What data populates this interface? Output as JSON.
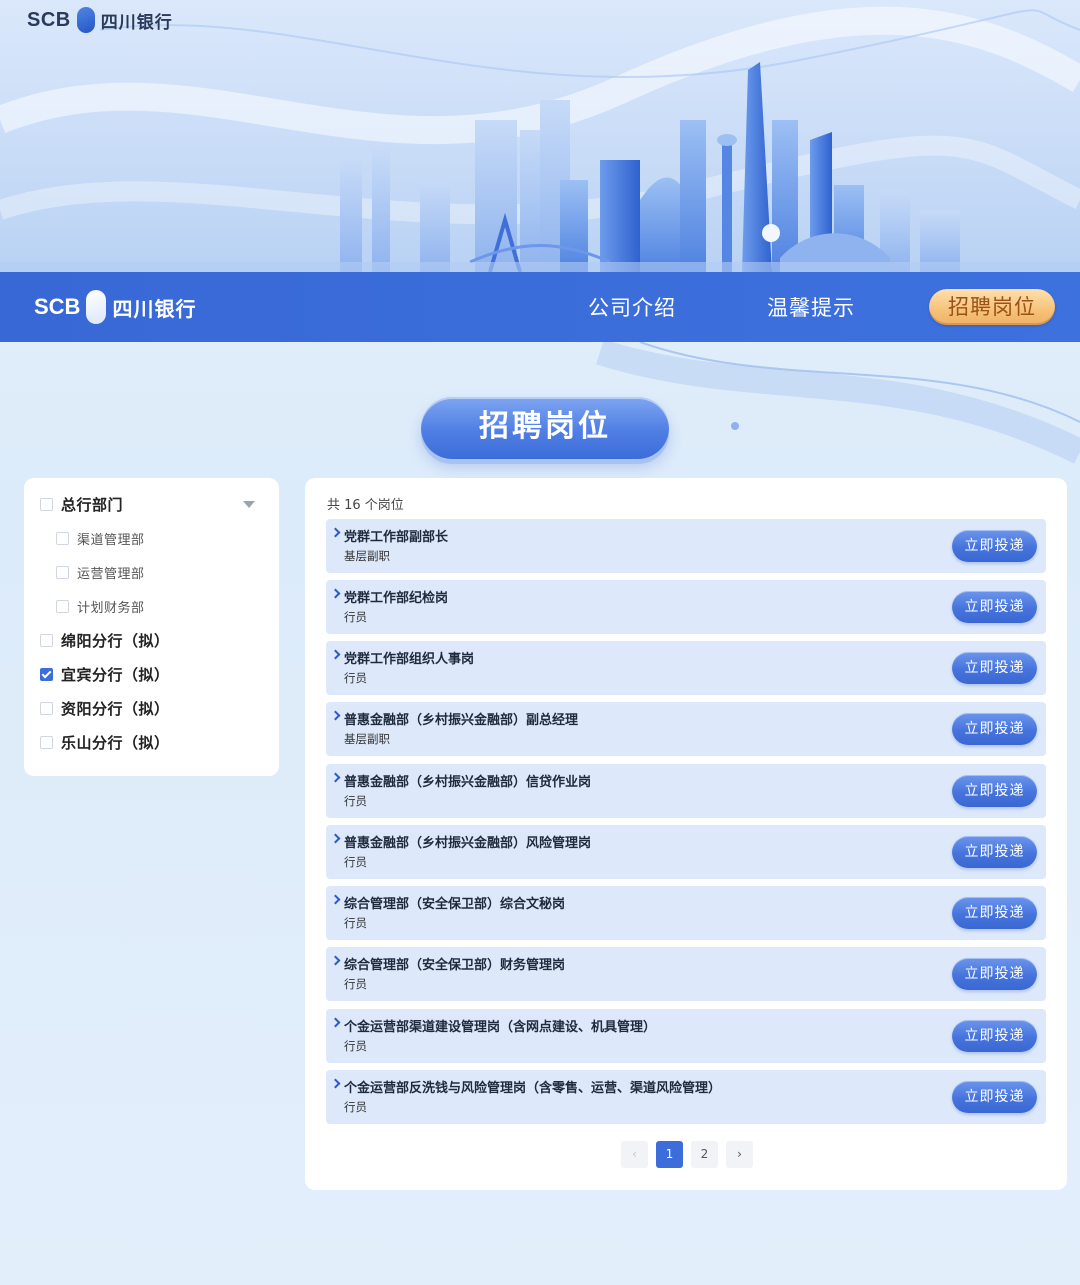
{
  "brand": {
    "latin": "SCB",
    "chinese": "四川银行"
  },
  "nav": {
    "company_intro": "公司介绍",
    "warm_tips": "温馨提示",
    "recruitment": "招聘岗位"
  },
  "section_title": "招聘岗位",
  "filters": {
    "groups": [
      {
        "label": "总行部门",
        "checked": false,
        "sub": true
      },
      {
        "label": "渠道管理部",
        "checked": false,
        "level": 2
      },
      {
        "label": "运营管理部",
        "checked": false,
        "level": 2
      },
      {
        "label": "计划财务部",
        "checked": false,
        "level": 2
      },
      {
        "label": "绵阳分行（拟）",
        "checked": false,
        "level": 1
      },
      {
        "label": "宜宾分行（拟）",
        "checked": true,
        "level": 1
      },
      {
        "label": "资阳分行（拟）",
        "checked": false,
        "level": 1
      },
      {
        "label": "乐山分行（拟）",
        "checked": false,
        "level": 1
      }
    ]
  },
  "jobs": {
    "count_text": "共 16 个岗位",
    "apply_label": "立即投递",
    "items": [
      {
        "title": "党群工作部副部长",
        "level": "基层副职"
      },
      {
        "title": "党群工作部纪检岗",
        "level": "行员"
      },
      {
        "title": "党群工作部组织人事岗",
        "level": "行员"
      },
      {
        "title": "普惠金融部（乡村振兴金融部）副总经理",
        "level": "基层副职"
      },
      {
        "title": "普惠金融部（乡村振兴金融部）信贷作业岗",
        "level": "行员"
      },
      {
        "title": "普惠金融部（乡村振兴金融部）风险管理岗",
        "level": "行员"
      },
      {
        "title": "综合管理部（安全保卫部）综合文秘岗",
        "level": "行员"
      },
      {
        "title": "综合管理部（安全保卫部）财务管理岗",
        "level": "行员"
      },
      {
        "title": "个金运营部渠道建设管理岗（含网点建设、机具管理）",
        "level": "行员"
      },
      {
        "title": "个金运营部反洗钱与风险管理岗（含零售、运营、渠道风险管理）",
        "level": "行员"
      }
    ]
  },
  "pagination": {
    "prev": "‹",
    "pages": [
      "1",
      "2"
    ],
    "current": "1",
    "next": "›"
  },
  "colors": {
    "nav_blue": "#3a6cd9",
    "accent_orange": "#f7c47d",
    "button_blue": "#4674dc"
  }
}
